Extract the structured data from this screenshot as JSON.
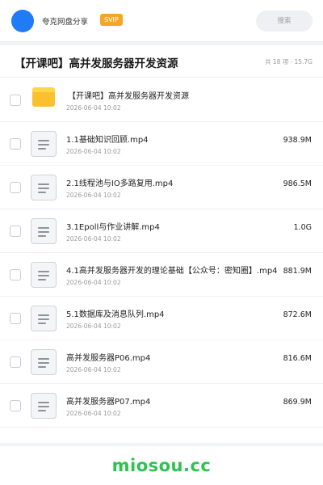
{
  "header": {
    "brand": "夸克网盘分享",
    "vip_badge": "SVIP",
    "search_placeholder": "搜索",
    "avatar_color": "#1f7bf6"
  },
  "share": {
    "title": "【开课吧】高并发服务器开发资源",
    "summary": "共 18 项 · 15.7G"
  },
  "files": [
    {
      "type": "folder",
      "icon": "folder-icon",
      "name": "【开课吧】高并发服务器开发资源",
      "date": "2026-06-04 10:02",
      "size": ""
    },
    {
      "type": "file",
      "icon": "document-icon",
      "name": "1.1基础知识回顾.mp4",
      "date": "2026-06-04 10:02",
      "size": "938.9M"
    },
    {
      "type": "file",
      "icon": "document-icon",
      "name": "2.1线程池与IO多路复用.mp4",
      "date": "2026-06-04 10:02",
      "size": "986.5M"
    },
    {
      "type": "file",
      "icon": "document-icon",
      "name": "3.1Epoll与作业讲解.mp4",
      "date": "2026-06-04 10:02",
      "size": "1.0G"
    },
    {
      "type": "file",
      "icon": "document-icon",
      "name": "4.1高并发服务器开发的理论基础【公众号：密知圈】.mp4",
      "date": "2026-06-04 10:02",
      "size": "881.9M"
    },
    {
      "type": "file",
      "icon": "document-icon",
      "name": "5.1数据库及消息队列.mp4",
      "date": "2026-06-04 10:02",
      "size": "872.6M"
    },
    {
      "type": "file",
      "icon": "document-icon",
      "name": "高并发服务器P06.mp4",
      "date": "2026-06-04 10:02",
      "size": "816.6M"
    },
    {
      "type": "file",
      "icon": "document-icon",
      "name": "高并发服务器P07.mp4",
      "date": "2026-06-04 10:02",
      "size": "869.9M"
    }
  ],
  "footer": {
    "watermark": "miosou.cc",
    "watermark_color": "#2ec24f"
  },
  "colors": {
    "folder": "#fbc02d",
    "vip_badge": "#f5a623"
  }
}
